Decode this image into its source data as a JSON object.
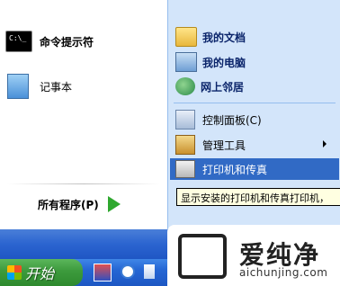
{
  "left_panel": {
    "items": [
      {
        "label": "命令提示符",
        "icon": "cmd-icon"
      },
      {
        "label": "记事本",
        "icon": "notepad-icon"
      }
    ],
    "all_programs_label": "所有程序(P)"
  },
  "right_panel": {
    "items": [
      {
        "label": "我的文档",
        "icon": "my-documents-icon"
      },
      {
        "label": "我的电脑",
        "icon": "my-computer-icon"
      },
      {
        "label": "网上邻居",
        "icon": "network-icon"
      },
      {
        "label": "控制面板(C)",
        "icon": "control-panel-icon"
      },
      {
        "label": "管理工具",
        "icon": "admin-tools-icon"
      },
      {
        "label": "打印机和传真",
        "icon": "printer-icon"
      }
    ]
  },
  "tooltip": "显示安装的打印机和传真打印机，",
  "taskbar": {
    "start_label": "开始"
  },
  "watermark": {
    "brand": "爱纯净",
    "url": "aichunjing.com"
  }
}
